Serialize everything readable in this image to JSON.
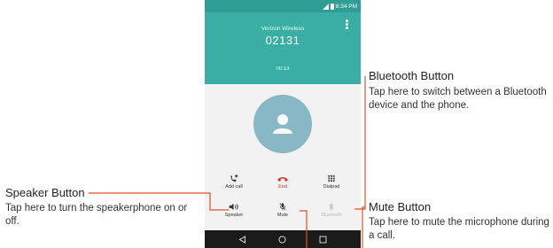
{
  "status_bar": {
    "time": "8:34 PM"
  },
  "call": {
    "carrier": "Verizon Wireless",
    "number": "02131",
    "timer": "00:13"
  },
  "controls": {
    "add_call": "Add call",
    "end": "End",
    "dialpad": "Dialpad",
    "speaker": "Speaker",
    "mute": "Mute",
    "bluetooth": "Bluetooth"
  },
  "callouts": {
    "bluetooth": {
      "title": "Bluetooth Button",
      "description": "Tap here to switch between a Bluetooth device and the phone."
    },
    "speaker": {
      "title": "Speaker Button",
      "description": "Tap here to turn the speakerphone on or off."
    },
    "mute": {
      "title": "Mute Button",
      "description": "Tap here to mute the microphone during a call."
    }
  },
  "colors": {
    "header": "#3aaea4",
    "status_bar": "#2e9d94",
    "avatar": "#88b7c6",
    "end": "#d9322b",
    "leader": "#e24c2b",
    "nav_bar": "#1b1b1b"
  }
}
